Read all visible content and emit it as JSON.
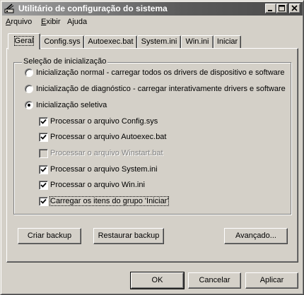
{
  "window": {
    "title": "Utilitário de configuração do sistema"
  },
  "menu": [
    "Arquivo",
    "Exibir",
    "Ajuda"
  ],
  "tabs": [
    "Geral",
    "Config.sys",
    "Autoexec.bat",
    "System.ini",
    "Win.ini",
    "Iniciar"
  ],
  "active_tab": "Geral",
  "startup": {
    "group_label": "Seleção de inicialização",
    "options": [
      {
        "label": "Inicialização normal - carregar todos os drivers de dispositivo e software",
        "selected": false
      },
      {
        "label": "Inicialização de diagnóstico - carregar interativamente drivers e software",
        "selected": false
      },
      {
        "label": "Inicialização seletiva",
        "selected": true
      }
    ],
    "selective": [
      {
        "label": "Processar o arquivo Config.sys",
        "checked": true,
        "enabled": true
      },
      {
        "label": "Processar o arquivo Autoexec.bat",
        "checked": true,
        "enabled": true
      },
      {
        "label": "Processar o arquivo Winstart.bat",
        "checked": false,
        "enabled": false
      },
      {
        "label": "Processar o arquivo  System.ini",
        "checked": true,
        "enabled": true
      },
      {
        "label": "Processar o arquivo Win.ini",
        "checked": true,
        "enabled": true
      },
      {
        "label": "Carregar os itens do grupo 'Iniciar'",
        "checked": true,
        "enabled": true
      }
    ]
  },
  "panel_buttons": {
    "backup": "Criar backup",
    "restore": "Restaurar backup",
    "advanced": "Avançado..."
  },
  "dialog_buttons": {
    "ok": "OK",
    "cancel": "Cancelar",
    "apply": "Aplicar"
  }
}
